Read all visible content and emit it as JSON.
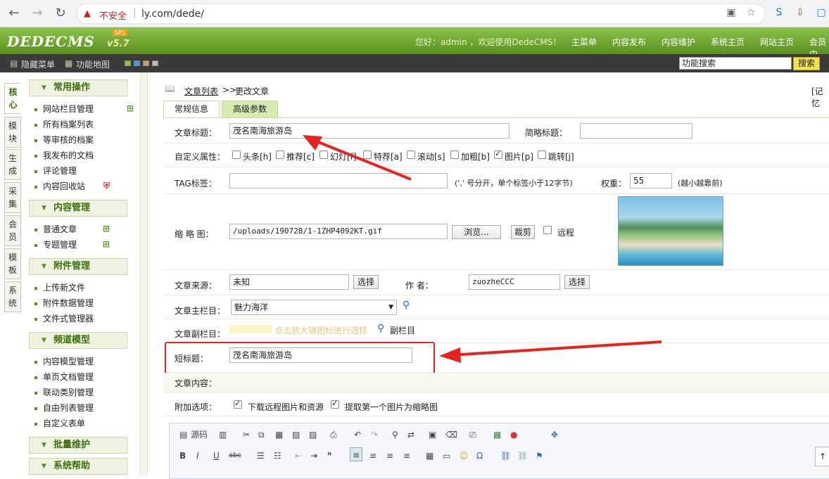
{
  "browser": {
    "insecure_label": "不安全",
    "url": "ly.com/dede/"
  },
  "topbar": {
    "logo": "DEDECMS",
    "version": "v5.7",
    "sp_badge": "SP1",
    "welcome": "您好：admin ，欢迎使用DedeCMS！",
    "nav": [
      "主菜单",
      "内容发布",
      "内容维护",
      "系统主页",
      "网站主页",
      "会员中"
    ]
  },
  "subbar": {
    "hide_menu": "隐藏菜单",
    "func_map": "功能地图",
    "search_value": "功能搜索",
    "search_button": "搜索"
  },
  "left_tabs": [
    "核心",
    "模块",
    "生成",
    "采集",
    "会员",
    "模板",
    "系统"
  ],
  "menu": {
    "groups": [
      {
        "title": "常用操作",
        "items": [
          "网站栏目管理",
          "所有档案列表",
          "等审核的档案",
          "我发布的文档",
          "评论管理",
          "内容回收站"
        ]
      },
      {
        "title": "内容管理",
        "items": [
          "普通文章",
          "专题管理"
        ]
      },
      {
        "title": "附件管理",
        "items": [
          "上传新文件",
          "附件数据管理",
          "文件式管理器"
        ]
      },
      {
        "title": "频道模型",
        "items": [
          "内容模型管理",
          "单页文档管理",
          "联动类别管理",
          "自由列表管理",
          "自定义表单"
        ]
      },
      {
        "title": "批量维护",
        "items": []
      },
      {
        "title": "系统帮助",
        "items": []
      }
    ]
  },
  "main": {
    "breadcrumb_link": "文章列表",
    "breadcrumb_sep": ">>",
    "breadcrumb_current": "更改文章",
    "record_link": "[记忆",
    "tabs": [
      "常规信息",
      "高级参数"
    ],
    "title_label": "文章标题：",
    "title_value": "茂名南海旅游岛",
    "short_title_label": "简略标题：",
    "short_title_value": "",
    "attr_label": "自定义属性：",
    "attrs": [
      {
        "label": "头条[h]",
        "checked": false
      },
      {
        "label": "推荐[c]",
        "checked": false
      },
      {
        "label": "幻灯[f]",
        "checked": false
      },
      {
        "label": "特荐[a]",
        "checked": false
      },
      {
        "label": "滚动[s]",
        "checked": false
      },
      {
        "label": "加粗[b]",
        "checked": false
      },
      {
        "label": "图片[p]",
        "checked": true
      },
      {
        "label": "跳转[j]",
        "checked": false
      }
    ],
    "tag_label": "TAG标签：",
    "tag_value": "",
    "tag_hint": "(',' 号分开，单个标签小于12字节)",
    "weight_label": "权重：",
    "weight_value": "55",
    "weight_hint": "(越小越靠前)",
    "thumb_label": "缩 略 图：",
    "thumb_value": "/uploads/190728/1-1ZHP4092KT.gif",
    "browse_button": "浏览...",
    "crop_button": "裁剪",
    "remote_label": "远程",
    "source_label": "文章来源：",
    "source_value": "未知",
    "select_button": "选择",
    "author_label": "作 者：",
    "author_value": "zuozheCCC",
    "main_column_label": "文章主栏目：",
    "main_column_value": "魅力海洋",
    "sub_column_label": "文章副栏目：",
    "sub_column_hint": "点击放大镜图标进行选择",
    "sub_column_link": "副栏目",
    "short_title2_label": "短标题：",
    "short_title2_value": "茂名南海旅游岛",
    "content_label": "文章内容：",
    "extra_label": "附加选项：",
    "extra_opts": [
      {
        "label": "下载远程图片和资源",
        "checked": true
      },
      {
        "label": "提取第一个图片为缩略图",
        "checked": true
      }
    ],
    "editor_source": "源码"
  },
  "colors": {
    "brand_green": "#5a8f1f",
    "annotation_red": "#e8231f"
  }
}
